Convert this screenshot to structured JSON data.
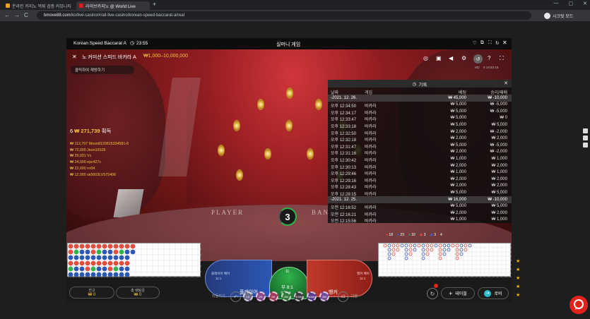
{
  "browser": {
    "tabs": [
      {
        "title": "온라인 카지노 먹튀 검증 커뮤니티",
        "active": false,
        "color": "#f0a020"
      },
      {
        "title": "라이브카지노 @ World Live",
        "active": true,
        "color": "#d81b1b"
      }
    ],
    "new_tab": "+",
    "url_host": "bmove88.com",
    "url_path": "/ko/live-casino/#/all-live-casino/korean-speed-baccarat-a/real",
    "profile_label": "시크릿 모드",
    "nav": {
      "back": "←",
      "forward": "→",
      "reload": "C",
      "minimize": "—",
      "maximize": "▢",
      "close": "✕"
    }
  },
  "game": {
    "table_name": "Korean Speed Baccarat A",
    "time": "23:55",
    "mode_title": "실머니 게임",
    "stream_title": "노 커미션 스피드 바카라 A",
    "limits": "₩1,000–10,000,000",
    "hint_text": "클릭하여 재방하기",
    "stream_info": "HD",
    "stream_clock": "# 14:53:15",
    "win_round": "6",
    "win_amount": "₩ 271,739",
    "win_label": "획득",
    "winners": [
      {
        "amount": "₩ 112,707",
        "name": "Moon8120815334581-8"
      },
      {
        "amount": "₩ 72,000",
        "name": "Jeon19105"
      },
      {
        "amount": "₩ 29,031",
        "name": "Vc"
      },
      {
        "amount": "₩ 24,000",
        "name": "epc427c"
      },
      {
        "amount": "₩ 22,000",
        "name": "rrr04"
      },
      {
        "amount": "₩ 12,000",
        "name": "sk5003LV575406"
      }
    ],
    "countdown": "3",
    "felt_player": "PLAYER",
    "felt_banker": "BANKER"
  },
  "history": {
    "title": "기록",
    "headers": [
      "날짜",
      "게임",
      "베팅",
      "승리/패배"
    ],
    "rows": [
      {
        "type": "date",
        "c1": "-2021. 12. 26.",
        "c2": "",
        "c3": "₩ 45,000",
        "c4": "₩ -10,000"
      },
      {
        "type": "row",
        "c1": "오후 12:34:50",
        "c2": "바카라",
        "c3": "₩ 5,000",
        "c4": "₩ -5,000"
      },
      {
        "type": "row",
        "c1": "오후 12:34:17",
        "c2": "바카라",
        "c3": "₩ 5,000",
        "c4": "₩ -5,000"
      },
      {
        "type": "row",
        "c1": "오후 12:33:47",
        "c2": "바카라",
        "c3": "₩ 5,000",
        "c4": "₩ 0"
      },
      {
        "type": "row",
        "c1": "오후 12:33:18",
        "c2": "바카라",
        "c3": "₩ 5,000",
        "c4": "₩ 5,000"
      },
      {
        "type": "row",
        "c1": "오후 12:32:50",
        "c2": "바카라",
        "c3": "₩ 2,000",
        "c4": "₩ -2,000"
      },
      {
        "type": "row",
        "c1": "오후 12:32:18",
        "c2": "바카라",
        "c3": "₩ 2,000",
        "c4": "₩ 2,000"
      },
      {
        "type": "row",
        "c1": "오후 12:31:47",
        "c2": "바카라",
        "c3": "₩ 5,000",
        "c4": "₩ -5,000"
      },
      {
        "type": "row",
        "c1": "오후 12:31:16",
        "c2": "바카라",
        "c3": "₩ 2,000",
        "c4": "₩ -2,000"
      },
      {
        "type": "row",
        "c1": "오후 12:30:42",
        "c2": "바카라",
        "c3": "₩ 1,000",
        "c4": "₩ 1,000"
      },
      {
        "type": "row",
        "c1": "오후 12:30:13",
        "c2": "바카라",
        "c3": "₩ 2,000",
        "c4": "₩ 2,000"
      },
      {
        "type": "row",
        "c1": "오후 12:29:46",
        "c2": "바카라",
        "c3": "₩ 1,000",
        "c4": "₩ 1,000"
      },
      {
        "type": "row",
        "c1": "오후 12:29:16",
        "c2": "바카라",
        "c3": "₩ 2,000",
        "c4": "₩ 2,000"
      },
      {
        "type": "row",
        "c1": "오후 12:28:43",
        "c2": "바카라",
        "c3": "₩ 2,000",
        "c4": "₩ 2,000"
      },
      {
        "type": "row",
        "c1": "오후 12:28:15",
        "c2": "바카라",
        "c3": "₩ 5,000",
        "c4": "₩ 5,000"
      },
      {
        "type": "date",
        "c1": "-2021. 12. 25.",
        "c2": "",
        "c3": "₩ 16,000",
        "c4": "₩ -10,000"
      },
      {
        "type": "row",
        "c1": "오전 12:16:52",
        "c2": "바카라",
        "c3": "₩ 5,000",
        "c4": "₩ 5,000"
      },
      {
        "type": "row",
        "c1": "오전 12:16:21",
        "c2": "바카라",
        "c3": "₩ 2,000",
        "c4": "₩ 2,000"
      },
      {
        "type": "row",
        "c1": "오전 12:15:56",
        "c2": "바카라",
        "c3": "₩ 1,000",
        "c4": "₩ 1,000"
      }
    ]
  },
  "betting": {
    "player_pair": "플레이어 페어",
    "player_pair_odds": "11:1",
    "player": "플레이어",
    "tie": "무 8:1",
    "tie_count": "11",
    "super6": "슈퍼6 8",
    "super6_odds": "15:1",
    "banker": "뱅커",
    "banker_pair": "뱅커 페어",
    "banker_pair_odds": "11:1",
    "undo": "되돌리기",
    "double": "x2",
    "double_label": "더블",
    "chips": [
      "1K",
      "2K",
      "5K",
      "25K",
      "100K",
      "500K",
      "2M"
    ],
    "balance_label": "잔고",
    "balance_value": "₩ 0",
    "total_bet_label": "총 배팅금",
    "total_bet_value": "₩ 0",
    "tables_label": "테이블",
    "lobby_label": "로비",
    "stats": {
      "banker": "18",
      "player": "23",
      "tie": "32",
      "bpair": "3",
      "ppair": "3",
      "count": "4"
    }
  },
  "colors": {
    "accent_gold": "#f3c238",
    "banker_red": "#c0392b",
    "player_blue": "#2c57b5",
    "tie_green": "#1f8f3a"
  }
}
